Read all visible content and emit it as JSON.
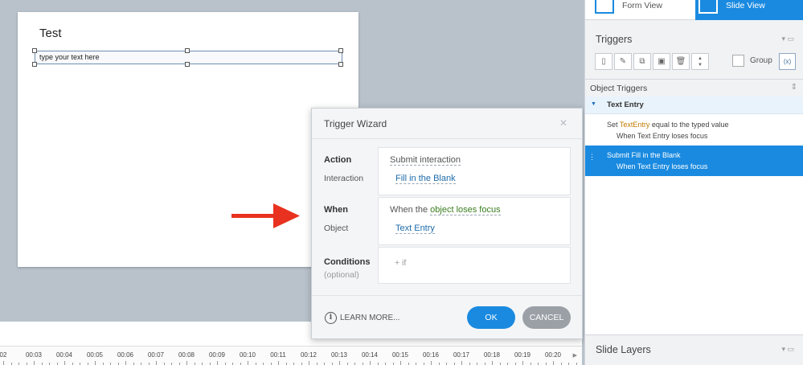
{
  "slide": {
    "title": "Test",
    "text_entry_placeholder": "type your text here"
  },
  "timeline": {
    "ticks": [
      "02",
      "00:03",
      "00:04",
      "00:05",
      "00:06",
      "00:07",
      "00:08",
      "00:09",
      "00:10",
      "00:11",
      "00:12",
      "00:13",
      "00:14",
      "00:15",
      "00:16",
      "00:17",
      "00:18",
      "00:19",
      "00:20"
    ]
  },
  "dialog": {
    "title": "Trigger Wizard",
    "close_icon": "close-icon",
    "action_label": "Action",
    "action_value": "Submit interaction",
    "interaction_label": "Interaction",
    "interaction_value": "Fill in the Blank",
    "when_label": "When",
    "when_prefix": "When the",
    "when_value": "object loses focus",
    "object_label": "Object",
    "object_value": "Text Entry",
    "conditions_label": "Conditions",
    "conditions_optional": "(optional)",
    "add_condition": "+ if",
    "learn_more": "LEARN MORE...",
    "ok": "OK",
    "cancel": "CANCEL"
  },
  "panel": {
    "tabs": {
      "form_view": "Form View",
      "slide_view": "Slide View"
    },
    "triggers_title": "Triggers",
    "group_label": "Group",
    "object_triggers_title": "Object Triggers",
    "group_name": "Text Entry",
    "trigger1": {
      "set": "Set",
      "variable": "TextEntry",
      "rest": "equal to the typed value",
      "when": "When Text Entry loses focus"
    },
    "trigger2": {
      "line1": "Submit Fill in the Blank",
      "when": "When Text Entry loses focus"
    },
    "slide_layers_title": "Slide Layers"
  },
  "colors": {
    "accent": "#1a8ae0",
    "arrow": "#e8321f",
    "canvas": "#b9c2cb"
  }
}
